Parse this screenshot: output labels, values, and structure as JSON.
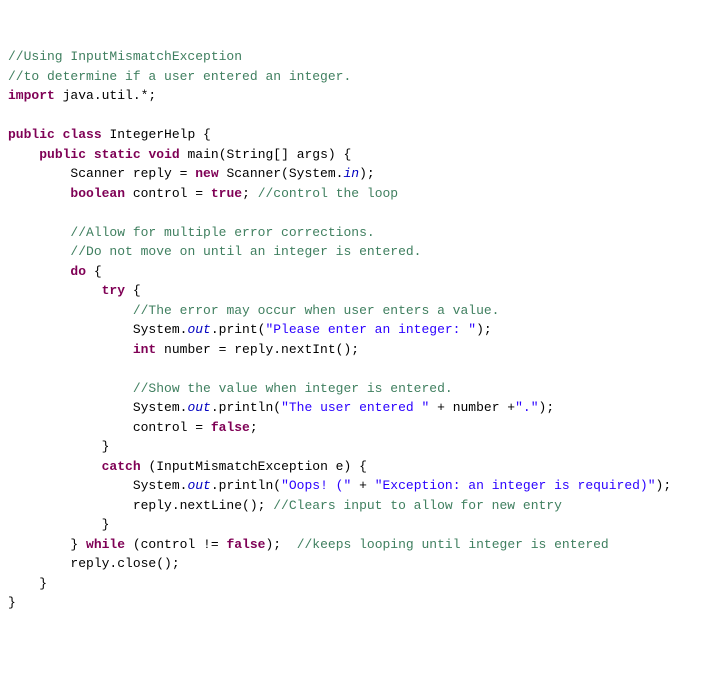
{
  "code": {
    "c1": "//Using InputMismatchException",
    "c2": "//to determine if a user entered an integer.",
    "kw_import": "import",
    "imp_rest": " java.util.*;",
    "kw_public1": "public",
    "kw_class": "class",
    "cls_name": " IntegerHelp {",
    "kw_public2": "public",
    "kw_static": "static",
    "kw_void": "void",
    "main_sig": " main(String[] args) {",
    "scanner_lead": "        Scanner reply = ",
    "kw_new": "new",
    "scanner_ctor": " Scanner(System.",
    "sf_in": "in",
    "scanner_end": ");",
    "kw_boolean": "boolean",
    "ctrl_mid": " control = ",
    "kw_true": "true",
    "ctrl_semi": "; ",
    "c_ctrl": "//control the loop",
    "c_allow": "//Allow for multiple error corrections.",
    "c_donot": "//Do not move on until an integer is entered.",
    "kw_do": "do",
    "do_brace": " {",
    "kw_try": "try",
    "try_brace": " {",
    "c_err": "//The error may occur when user enters a value.",
    "sys1": "                System.",
    "sf_out": "out",
    "print1": ".print(",
    "str1": "\"Please enter an integer: \"",
    "print1_end": ");",
    "kw_int": "int",
    "num_rest": " number = reply.nextInt();",
    "c_show": "//Show the value when integer is entered.",
    "sys2": "                System.",
    "println2": ".println(",
    "str2": "\"The user entered \"",
    "plus_num": " + number +",
    "str_dot": "\".\"",
    "println2_end": ");",
    "ctrl2_lead": "                control = ",
    "kw_false": "false",
    "semi": ";",
    "close_try": "            }",
    "kw_catch": "catch",
    "catch_sig": " (InputMismatchException e) {",
    "sys3": "                System.",
    "println3": ".println(",
    "str3a": "\"Oops! (\"",
    "plus": " + ",
    "str3b": "\"Exception: an integer is required)\"",
    "println3_end": ");",
    "reply_next": "                reply.nextLine(); ",
    "c_clears": "//Clears input to allow for new entry",
    "close_catch": "            }",
    "while_lead": "        } ",
    "kw_while": "while",
    "while_mid": " (control != ",
    "while_end": ");  ",
    "c_keeps": "//keeps looping until integer is entered",
    "reply_close": "        reply.close();",
    "close_main": "    }",
    "close_class": "}"
  }
}
